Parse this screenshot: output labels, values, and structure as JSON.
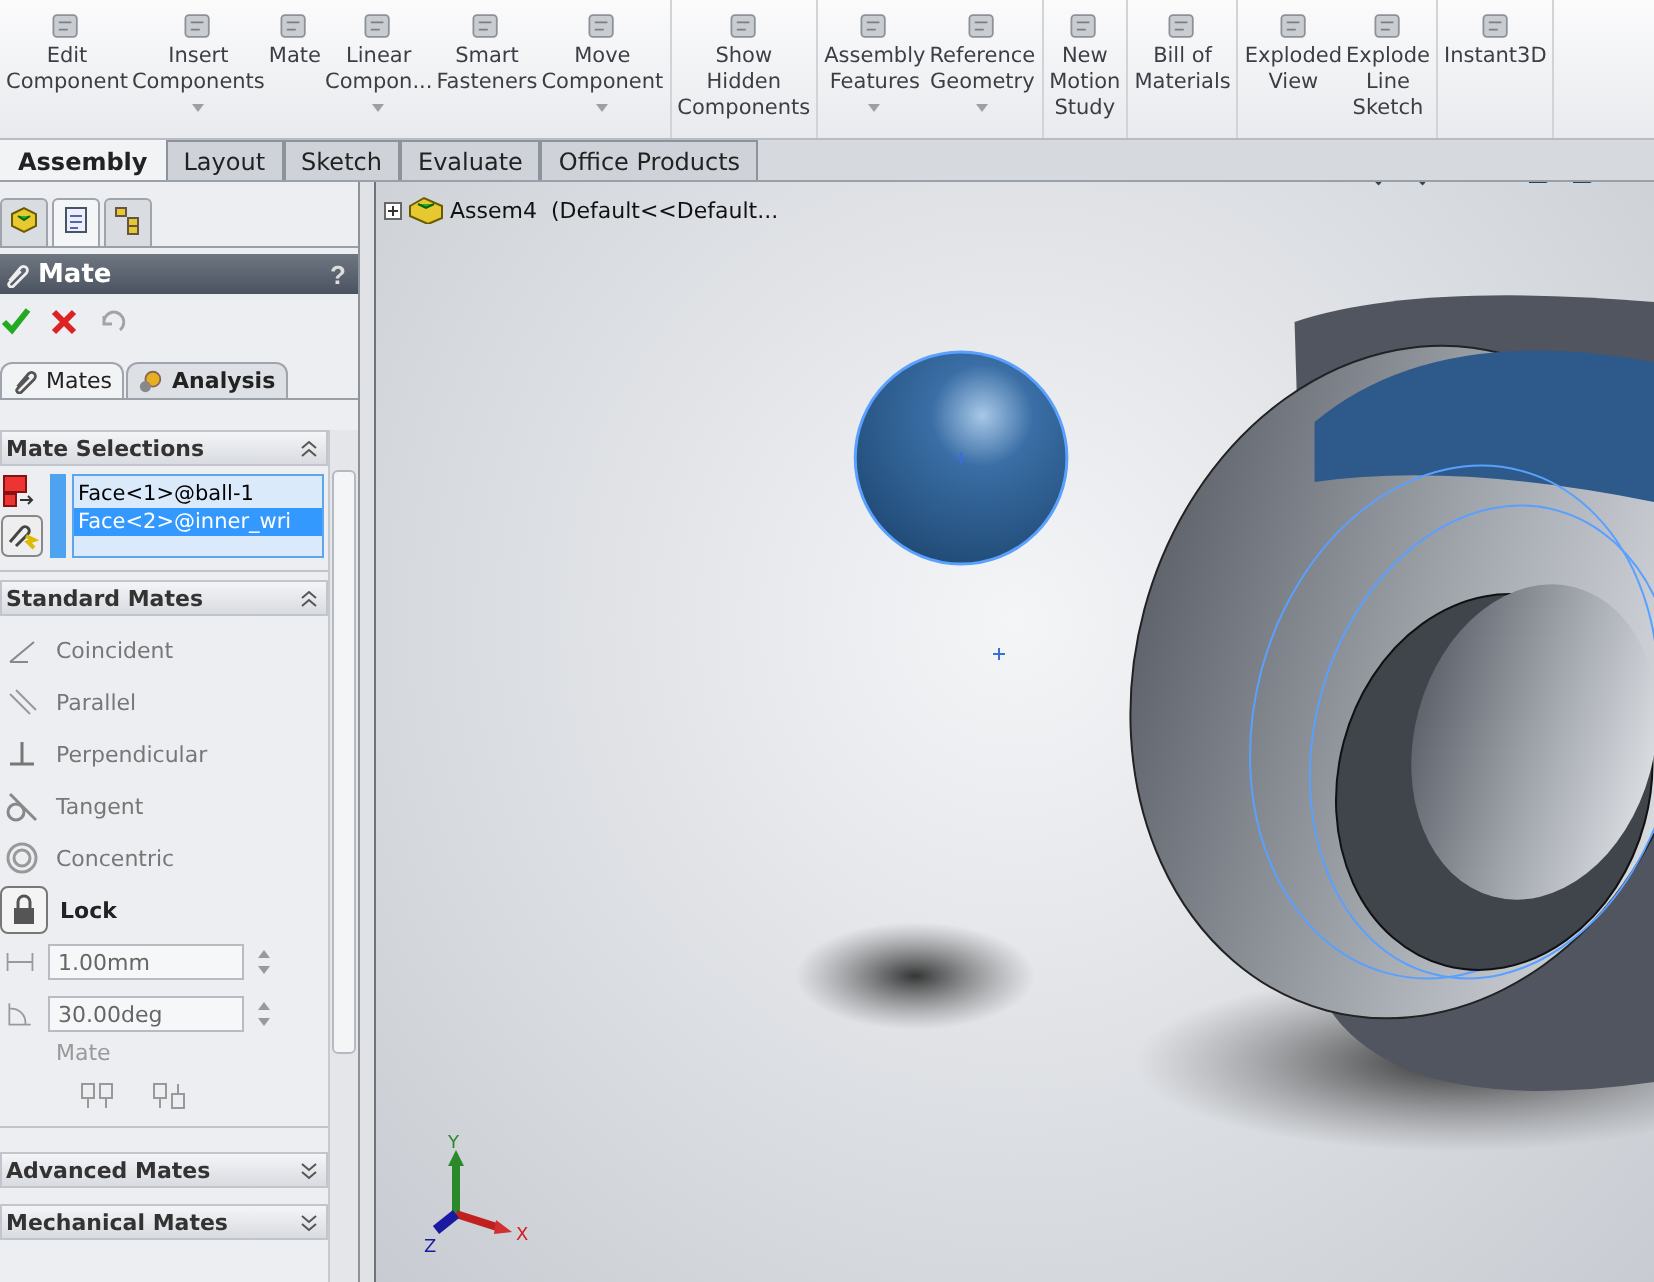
{
  "toolbar": {
    "groups": [
      {
        "buttons": [
          {
            "label": "Edit\nComponent",
            "dropdown": false
          },
          {
            "label": "Insert\nComponents",
            "dropdown": true
          },
          {
            "label": "Mate",
            "dropdown": false
          },
          {
            "label": "Linear\nCompon...",
            "dropdown": true
          },
          {
            "label": "Smart\nFasteners",
            "dropdown": false
          },
          {
            "label": "Move\nComponent",
            "dropdown": true
          }
        ]
      },
      {
        "buttons": [
          {
            "label": "Show\nHidden\nComponents",
            "dropdown": false
          }
        ]
      },
      {
        "buttons": [
          {
            "label": "Assembly\nFeatures",
            "dropdown": true
          },
          {
            "label": "Reference\nGeometry",
            "dropdown": true
          }
        ]
      },
      {
        "buttons": [
          {
            "label": "New\nMotion\nStudy",
            "dropdown": false
          }
        ]
      },
      {
        "buttons": [
          {
            "label": "Bill of\nMaterials",
            "dropdown": false
          }
        ]
      },
      {
        "buttons": [
          {
            "label": "Exploded\nView",
            "dropdown": false
          },
          {
            "label": "Explode\nLine\nSketch",
            "dropdown": false
          }
        ]
      },
      {
        "buttons": [
          {
            "label": "Instant3D",
            "dropdown": false
          }
        ]
      }
    ]
  },
  "tabs": [
    {
      "label": "Assembly",
      "selected": true
    },
    {
      "label": "Layout",
      "selected": false
    },
    {
      "label": "Sketch",
      "selected": false
    },
    {
      "label": "Evaluate",
      "selected": false
    },
    {
      "label": "Office Products",
      "selected": false
    }
  ],
  "panel_tabs": [
    {
      "selected": false
    },
    {
      "selected": true
    },
    {
      "selected": false
    }
  ],
  "property_manager": {
    "title": "Mate",
    "help": "?",
    "subtabs": [
      {
        "label": "Mates",
        "selected": true
      },
      {
        "label": "Analysis",
        "selected": false
      }
    ],
    "mate_selections": {
      "title": "Mate Selections",
      "expanded": true,
      "items": [
        {
          "label": "Face<1>@ball-1",
          "selected": false
        },
        {
          "label": "Face<2>@inner_wri",
          "selected": true
        }
      ]
    },
    "standard_mates": {
      "title": "Standard Mates",
      "expanded": true,
      "items": [
        {
          "label": "Coincident",
          "selected": false
        },
        {
          "label": "Parallel",
          "selected": false
        },
        {
          "label": "Perpendicular",
          "selected": false
        },
        {
          "label": "Tangent",
          "selected": false
        },
        {
          "label": "Concentric",
          "selected": false
        },
        {
          "label": "Lock",
          "selected": true
        }
      ],
      "distance": {
        "value": "1.00mm",
        "disabled": true
      },
      "angle": {
        "value": "30.00deg",
        "disabled": true
      },
      "alignment_label": "Mate"
    },
    "collapsed_sections": [
      {
        "title": "Advanced Mates",
        "expanded": false
      },
      {
        "title": "Mechanical Mates",
        "expanded": false
      }
    ]
  },
  "tree": {
    "root": {
      "label": "Assem4  (Default<<Default...",
      "expanded": false
    }
  },
  "triad": {
    "x": "X",
    "y": "Y",
    "z": "Z"
  }
}
